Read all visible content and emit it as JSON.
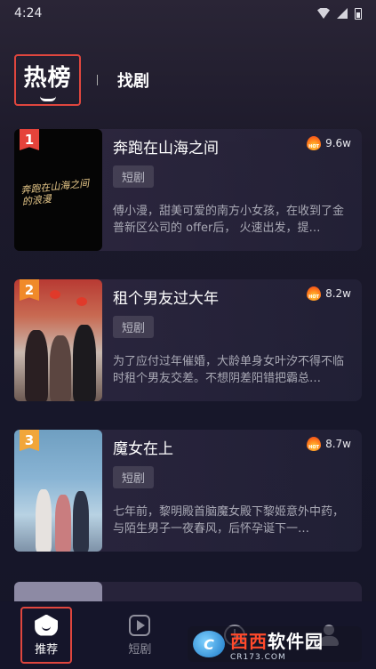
{
  "status_bar": {
    "time": "4:24"
  },
  "tabs": {
    "hot": "热榜",
    "find": "找剧"
  },
  "items": [
    {
      "rank": "1",
      "title": "奔跑在山海之间",
      "heat": "9.6w",
      "tag": "短剧",
      "desc": "傅小漫，甜美可爱的南方小女孩，在收到了金普新区公司的 offer后， 火速出发，提…",
      "thumb_text": "奔跑在山海之间的浪漫"
    },
    {
      "rank": "2",
      "title": "租个男友过大年",
      "heat": "8.2w",
      "tag": "短剧",
      "desc": "为了应付过年催婚，大龄单身女叶汐不得不临时租个男友交差。不想阴差阳错把霸总…"
    },
    {
      "rank": "3",
      "title": "魔女在上",
      "heat": "8.7w",
      "tag": "短剧",
      "desc": "七年前，黎明殿首脑魔女殿下黎姬意外中药，与陌生男子一夜春风，后怀孕诞下一…"
    }
  ],
  "nav": {
    "recommend": "推荐",
    "short_drama": "短剧"
  },
  "icons": {
    "heat": "fire-icon",
    "recommend": "home-icon",
    "short_drama": "play-icon",
    "history": "clock-icon",
    "profile": "user-icon"
  },
  "colors": {
    "accent_red": "#e0463e",
    "rank_1": "#e5433b",
    "rank_2": "#f08a2a",
    "rank_3": "#f1a63a"
  }
}
